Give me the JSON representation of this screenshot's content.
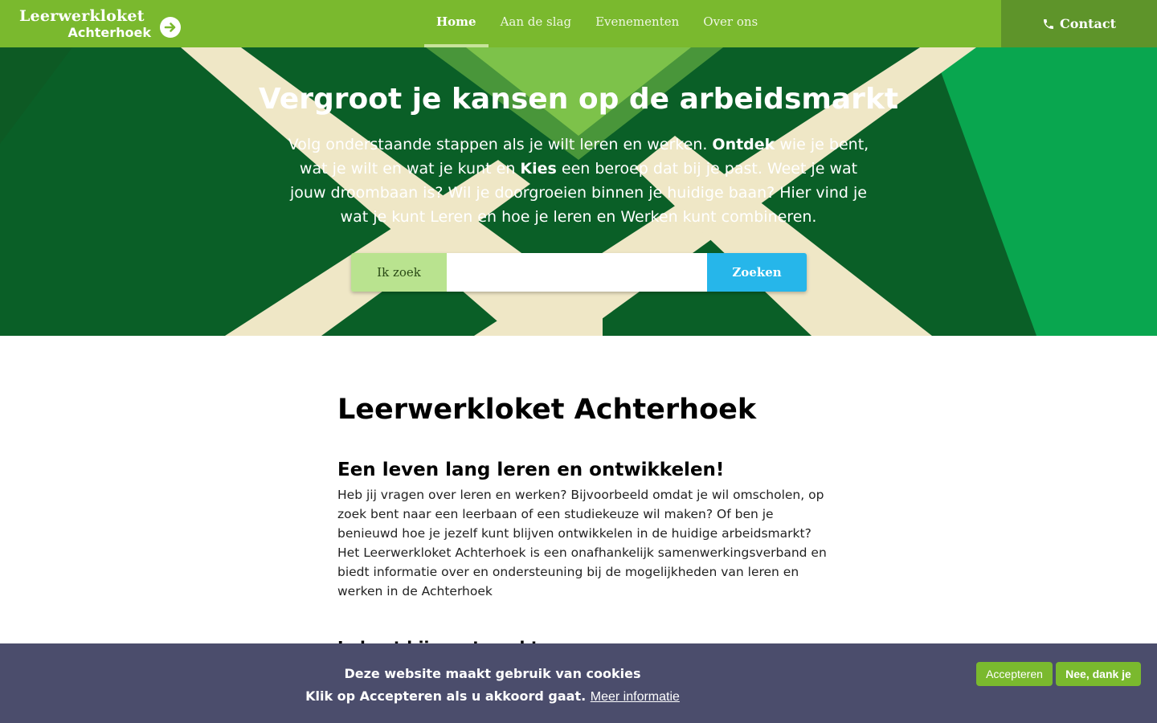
{
  "logo": {
    "line1": "Leerwerkloket",
    "line2": "Achterhoek"
  },
  "nav": {
    "items": [
      {
        "label": "Home",
        "active": true
      },
      {
        "label": "Aan de slag",
        "active": false
      },
      {
        "label": "Evenementen",
        "active": false
      },
      {
        "label": "Over ons",
        "active": false
      }
    ],
    "contact_label": "Contact"
  },
  "hero": {
    "title": "Vergroot je kansen op de arbeidsmarkt",
    "text_part1": "Volg onderstaande stappen als je wilt leren en werken. ",
    "text_bold1": "Ontdek",
    "text_part2": " wie je bent, wat je wilt en wat je kunt en ",
    "text_bold2": "Kies",
    "text_part3": " een beroep dat bij je past. Weet je wat jouw droombaan is? Wil je doorgroeien binnen je huidige baan? Hier vind je wat je kunt Leren en hoe je leren en Werken kunt combineren."
  },
  "search": {
    "label": "Ik zoek",
    "value": "",
    "placeholder": "",
    "button_label": "Zoeken"
  },
  "content": {
    "page_title": "Leerwerkloket Achterhoek",
    "section1_title": "Een leven lang leren en ontwikkelen!",
    "section1_text": "Heb jij vragen over leren en werken? Bijvoorbeeld omdat je wil omscholen, op zoek bent naar een leerbaan of een studiekeuze wil maken? Of ben je benieuwd hoe je jezelf kunt blijven ontwikkelen in de huidige arbeidsmarkt? Het Leerwerkloket Achterhoek is een onafhankelijk samenwerkingsverband en biedt informatie over en ondersteuning bij de mogelijkheden van leren en werken in de Achterhoek",
    "section2_title": "Je kunt bij ons terecht voor"
  },
  "cookie": {
    "line1": "Deze website maakt gebruik van cookies",
    "line2": "Klik op Accepteren als u akkoord gaat.",
    "link_label": "Meer informatie",
    "accept_label": "Accepteren",
    "decline_label": "Nee, dank je"
  },
  "colors": {
    "header_green": "#7ab92e",
    "contact_green": "#5e942a",
    "hero_dark_green": "#0a5f27",
    "hero_cream": "#efe7c6",
    "search_blue": "#26b6ea",
    "cookie_bg": "#4b4d6c"
  },
  "icons": {
    "logo_arrow": "arrow-right-circle-icon",
    "contact_phone": "phone-icon"
  }
}
